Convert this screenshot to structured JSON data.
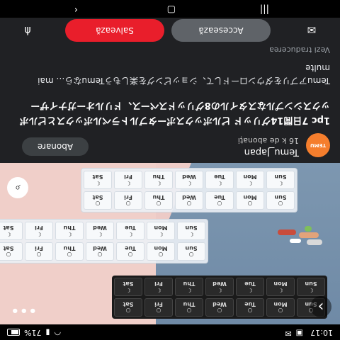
{
  "status_bar": {
    "time": "10:17",
    "battery": "71%"
  },
  "product_image": {
    "black_days": [
      "Sun",
      "Mon",
      "Tue",
      "Wed",
      "Thu",
      "Fri",
      "Sat"
    ],
    "white_days": [
      "Sun",
      "Mon",
      "Tue",
      "Wed",
      "Thu",
      "Fri",
      "Sat"
    ],
    "more": "•••"
  },
  "seller": {
    "avatar_text": "TEMU",
    "name": "Temu_Japan",
    "subscribers": "16 k de abonați",
    "subscribe_label": "Abonare"
  },
  "pin": {
    "title": "1pc 7日間14グリッド ピルボックスポータブルトラベルボックスとピルボックスシンプルなスタイルの8グリッドスペース、ドリルオーガナイザー",
    "description": "Temuアプリをダウンロードして、ショッピングを楽しもうTemuなら… mai multe",
    "translate_link": "Vezi traducerea"
  },
  "actions": {
    "visit_label": "Accesează",
    "save_label": "Salvează"
  },
  "colors": {
    "accent_red": "#e91e2b",
    "background": "#202124"
  }
}
